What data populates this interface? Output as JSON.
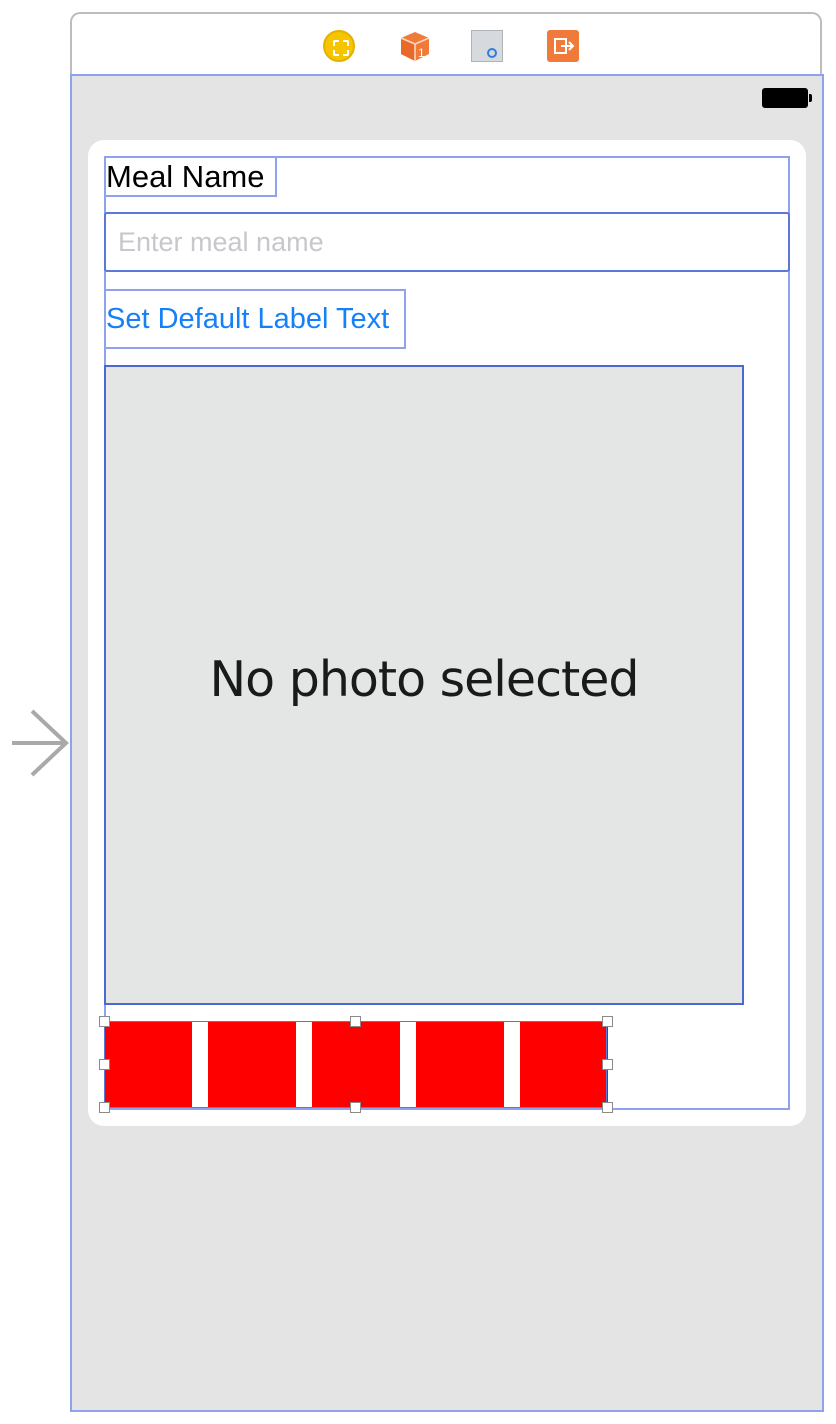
{
  "dock": {
    "icons": [
      "view-controller-icon",
      "first-responder-icon",
      "view-icon",
      "exit-icon"
    ],
    "first_responder_badge": "1"
  },
  "status_bar": {
    "battery": "battery-icon"
  },
  "form": {
    "meal_label": "Meal Name",
    "meal_field": {
      "value": "",
      "placeholder": "Enter meal name"
    },
    "set_default_button": "Set Default Label Text",
    "photo_placeholder": "No photo selected"
  },
  "rating": {
    "star_count": 5,
    "star_color": "#FF0000",
    "buttons": [
      "star",
      "star",
      "star",
      "star",
      "star"
    ]
  },
  "colors": {
    "canvas_background": "#E4E4E4",
    "selection_outline": "#8EA2F0",
    "tint_blue": "#1680F7"
  }
}
